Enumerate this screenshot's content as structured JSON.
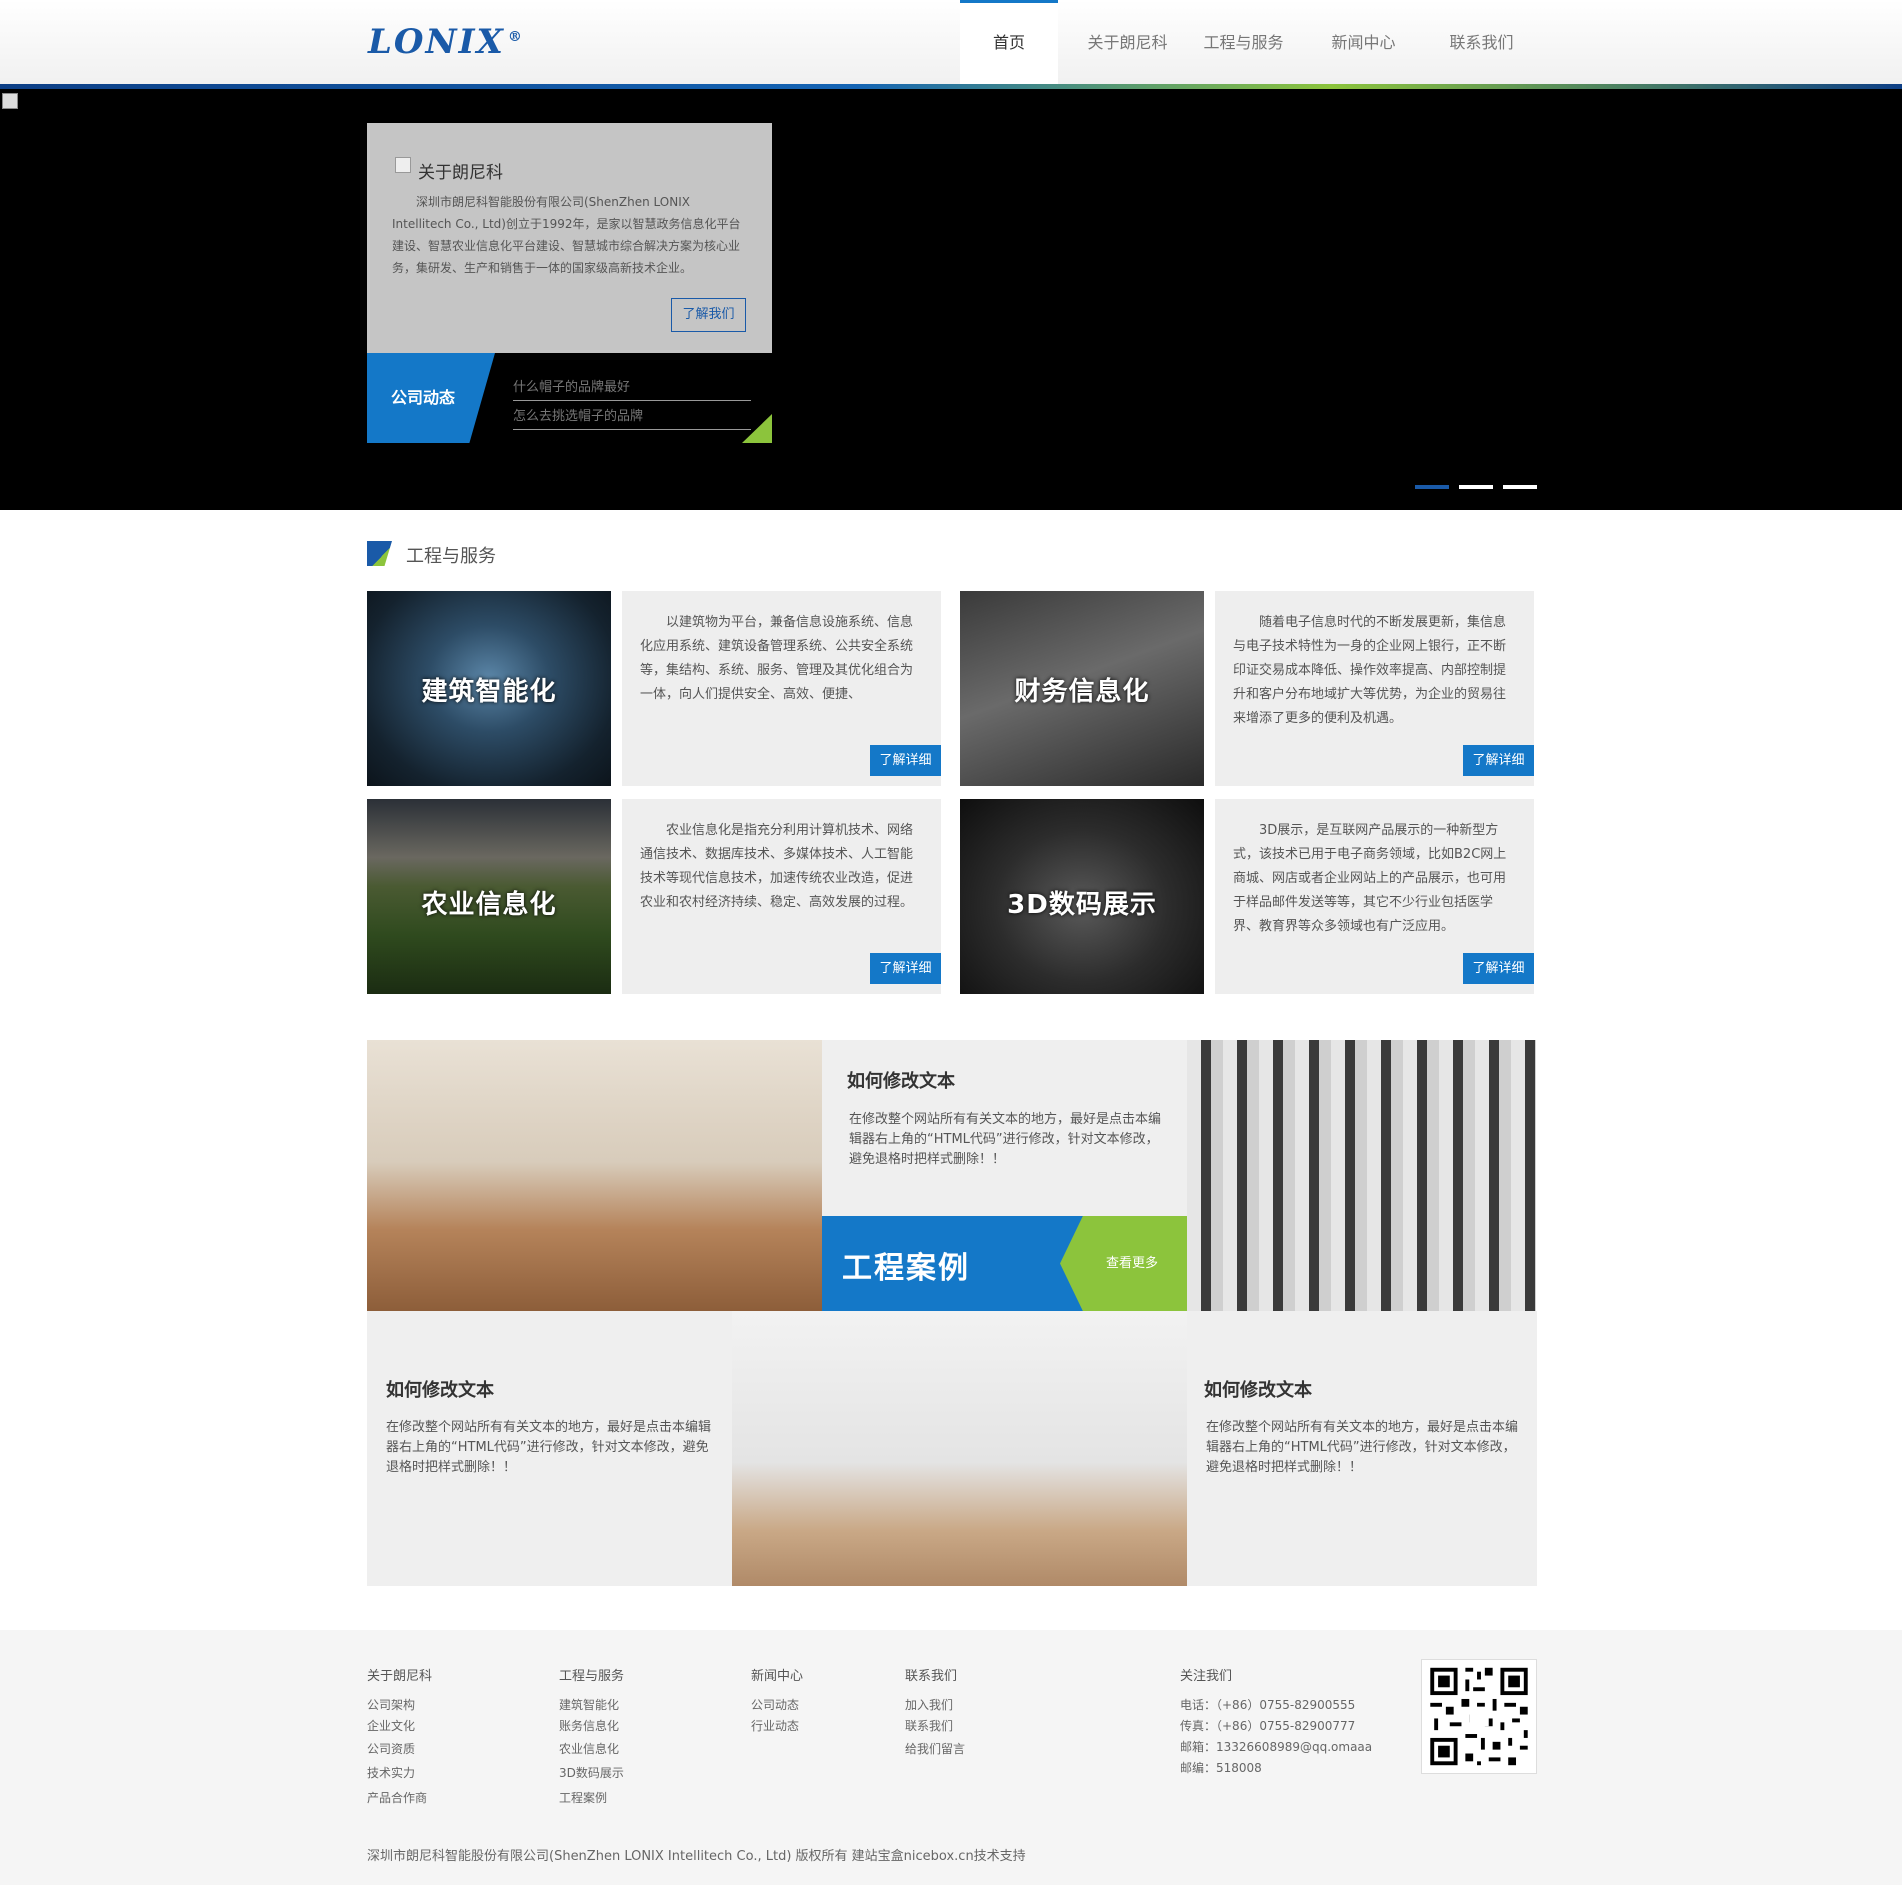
{
  "header": {
    "logo": "LONIX",
    "logo_mark": "®",
    "nav": [
      "首页",
      "关于朗尼科",
      "工程与服务",
      "新闻中心",
      "联系我们"
    ]
  },
  "banner": {
    "about_title": "关于朗尼科",
    "about_text": "深圳市朗尼科智能股份有限公司(ShenZhen LONIX Intellitech Co., Ltd)创立于1992年，是家以智慧政务信息化平台建设、智慧农业信息化平台建设、智慧城市综合解决方案为核心业务，集研发、生产和销售于一体的国家级高新技术企业。",
    "about_button": "了解我们",
    "news_label": "公司动态",
    "news": [
      "什么帽子的品牌最好",
      "怎么去挑选帽子的品牌"
    ]
  },
  "services": {
    "title": "工程与服务",
    "items": [
      {
        "image_label": "建筑智能化",
        "text": "以建筑物为平台，兼备信息设施系统、信息化应用系统、建筑设备管理系统、公共安全系统等，集结构、系统、服务、管理及其优化组合为一体，向人们提供安全、高效、便捷、",
        "button": "了解详细"
      },
      {
        "image_label": "财务信息化",
        "text": "随着电子信息时代的不断发展更新，集信息与电子技术特性为一身的企业网上银行，正不断印证交易成本降低、操作效率提高、内部控制提升和客户分布地域扩大等优势，为企业的贸易往来增添了更多的便利及机遇。",
        "button": "了解详细"
      },
      {
        "image_label": "农业信息化",
        "text": "农业信息化是指充分利用计算机技术、网络通信技术、数据库技术、多媒体技术、人工智能技术等现代信息技术，加速传统农业改造，促进农业和农村经济持续、稳定、高效发展的过程。",
        "button": "了解详细"
      },
      {
        "image_label": "3D数码展示",
        "text": "3D展示，是互联网产品展示的一种新型方式，该技术已用于电子商务领域，比如B2C网上商城、网店或者企业网站上的产品展示，也可用于样品邮件发送等等，其它不少行业包括医学界、教育界等众多领域也有广泛应用。",
        "button": "了解详细"
      }
    ]
  },
  "cases": {
    "label": "工程案例",
    "more": "查看更多",
    "blocks": [
      {
        "title": "如何修改文本",
        "text": "在修改整个网站所有有关文本的地方，最好是点击本编辑器右上角的“HTML代码”进行修改，针对文本修改，避免退格时把样式删除！！"
      },
      {
        "title": "如何修改文本",
        "text": "在修改整个网站所有有关文本的地方，最好是点击本编辑器右上角的“HTML代码”进行修改，针对文本修改，避免退格时把样式删除！！"
      },
      {
        "title": "如何修改文本",
        "text": "在修改整个网站所有有关文本的地方，最好是点击本编辑器右上角的“HTML代码”进行修改，针对文本修改，避免退格时把样式删除！！"
      }
    ]
  },
  "footer": {
    "cols": [
      {
        "title": "关于朗尼科",
        "links": [
          "公司架构",
          "企业文化",
          "公司资质",
          "技术实力",
          "产品合作商"
        ]
      },
      {
        "title": "工程与服务",
        "links": [
          "建筑智能化",
          "账务信息化",
          "农业信息化",
          "3D数码展示",
          "工程案例"
        ]
      },
      {
        "title": "新闻中心",
        "links": [
          "公司动态",
          "行业动态"
        ]
      },
      {
        "title": "联系我们",
        "links": [
          "加入我们",
          "联系我们",
          "给我们留言"
        ]
      }
    ],
    "follow": {
      "title": "关注我们",
      "lines": [
        "电话：（+86）0755-82900555",
        "传真：（+86）0755-82900777",
        "邮箱：13326608989@qq.omaaa",
        "邮编：518008"
      ]
    },
    "copyright": "深圳市朗尼科智能股份有限公司(ShenZhen LONIX Intellitech Co., Ltd)   版权所有      建站宝盒nicebox.cn技术支持"
  }
}
